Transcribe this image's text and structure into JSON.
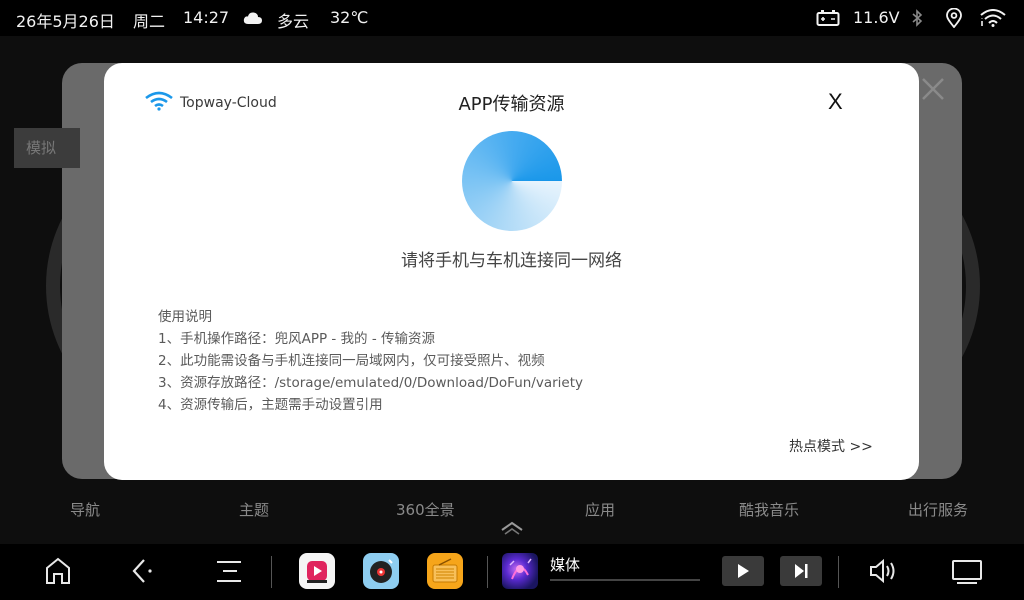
{
  "statusbar": {
    "date": "26年5月26日",
    "weekday": "周二",
    "time": "14:27",
    "weather_icon": "cloud-icon",
    "weather": "多云",
    "temperature": "32℃",
    "voltage": "11.6V"
  },
  "background": {
    "mode_label": "模拟"
  },
  "nav": {
    "items": [
      {
        "label": "导航"
      },
      {
        "label": "主题"
      },
      {
        "label": "360全景"
      },
      {
        "label": "应用"
      },
      {
        "label": "酷我音乐"
      },
      {
        "label": "出行服务"
      }
    ]
  },
  "modal": {
    "brand": "Topway-Cloud",
    "title": "APP传输资源",
    "close_label": "X",
    "hint": "请将手机与车机连接同一网络",
    "instructions_title": "使用说明",
    "instructions": [
      "1、手机操作路径：兜风APP - 我的 - 传输资源",
      "2、此功能需设备与手机连接同一局域网内，仅可接受照片、视频",
      "3、资源存放路径：/storage/emulated/0/Download/DoFun/variety",
      "4、资源传输后，主题需手动设置引用"
    ],
    "hotspot_link": "热点模式 >>"
  },
  "dock": {
    "media_label": "媒体",
    "media_progress": 0
  },
  "colors": {
    "accent_blue": "#1b98ea",
    "modal_bg": "#ffffff",
    "dock_bg": "#000000"
  }
}
